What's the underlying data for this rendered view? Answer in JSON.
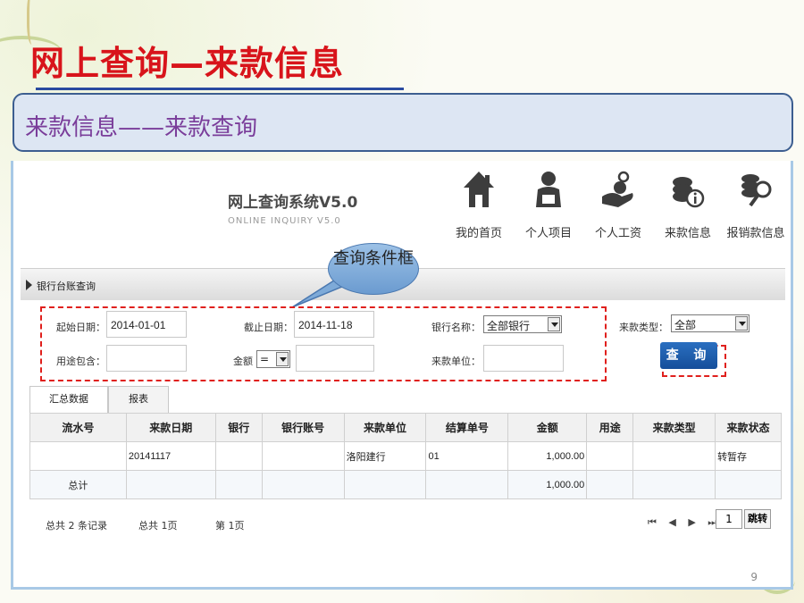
{
  "slide": {
    "title": "网上查询—来款信息",
    "subtitle": "来款信息——来款查询",
    "page_number": "9",
    "callout": "查询条件框"
  },
  "app": {
    "title": "网上查询系统V5.0",
    "subtitle": "ONLINE INQUIRY V5.0",
    "nav": [
      {
        "label": "我的首页",
        "icon": "home-icon"
      },
      {
        "label": "个人项目",
        "icon": "person-icon"
      },
      {
        "label": "个人工资",
        "icon": "salary-icon"
      },
      {
        "label": "来款信息",
        "icon": "coins-info-icon"
      },
      {
        "label": "报销款信息",
        "icon": "coins-search-icon"
      }
    ]
  },
  "section": {
    "title": "银行台账查询"
  },
  "form": {
    "start_date_label": "起始日期：",
    "start_date_value": "2014-01-01",
    "end_date_label": "截止日期：",
    "end_date_value": "2014-11-18",
    "bank_label": "银行名称：",
    "bank_value": "全部银行",
    "type_label": "来款类型：",
    "type_value": "全部",
    "purpose_label": "用途包含：",
    "purpose_value": "",
    "amount_label": "金额",
    "amount_op": "=",
    "amount_value": "",
    "unit_label": "来款单位：",
    "unit_value": "",
    "query_button": "查 询"
  },
  "tabs": [
    "汇总数据",
    "报表"
  ],
  "table": {
    "headers": [
      "流水号",
      "来款日期",
      "银行",
      "银行账号",
      "来款单位",
      "结算单号",
      "金额",
      "用途",
      "来款类型",
      "来款状态"
    ],
    "rows": [
      [
        "",
        "20141117",
        "",
        "",
        "洛阳建行",
        "01",
        "1,000.00",
        "",
        "",
        "转暂存"
      ]
    ],
    "total": {
      "label": "总计",
      "amount": "1,000.00"
    }
  },
  "footer": {
    "records": "总共 2 条记录",
    "pages": "总共 1页",
    "current": "第 1页",
    "pager": "⏮ ◀ ▶ ⏭",
    "page_input": "1",
    "go_button": "跳转"
  },
  "colors": {
    "title_red": "#d8141b",
    "subtitle_purple": "#7a3d9a",
    "dash_red": "#e0201d",
    "button_blue": "#1d5fae"
  }
}
